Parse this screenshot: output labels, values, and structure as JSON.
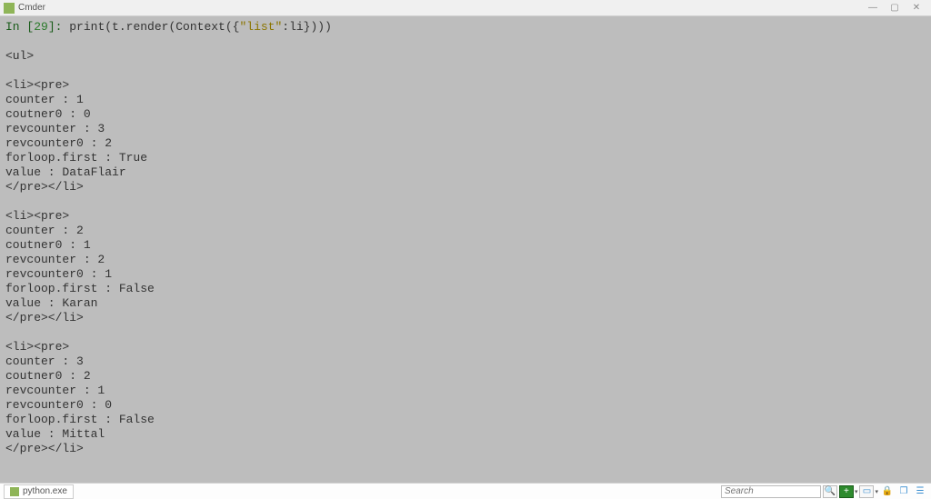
{
  "titlebar": {
    "title": "Cmder"
  },
  "prompt": {
    "in_label": "In [",
    "number": "29",
    "close": "]: ",
    "code_prefix": "print(t.render(Context({",
    "str_literal": "\"list\"",
    "code_suffix": ":li})))"
  },
  "output_lines": [
    "",
    "<ul>",
    "",
    "<li><pre>",
    "counter : 1",
    "coutner0 : 0",
    "revcounter : 3",
    "revcounter0 : 2",
    "forloop.first : True",
    "value : DataFlair",
    "</pre></li>",
    "",
    "<li><pre>",
    "counter : 2",
    "coutner0 : 1",
    "revcounter : 2",
    "revcounter0 : 1",
    "forloop.first : False",
    "value : Karan",
    "</pre></li>",
    "",
    "<li><pre>",
    "counter : 3",
    "coutner0 : 2",
    "revcounter : 1",
    "revcounter0 : 0",
    "forloop.first : False",
    "value : Mittal",
    "</pre></li>"
  ],
  "statusbar": {
    "tab_label": "python.exe",
    "search_placeholder": "Search"
  }
}
